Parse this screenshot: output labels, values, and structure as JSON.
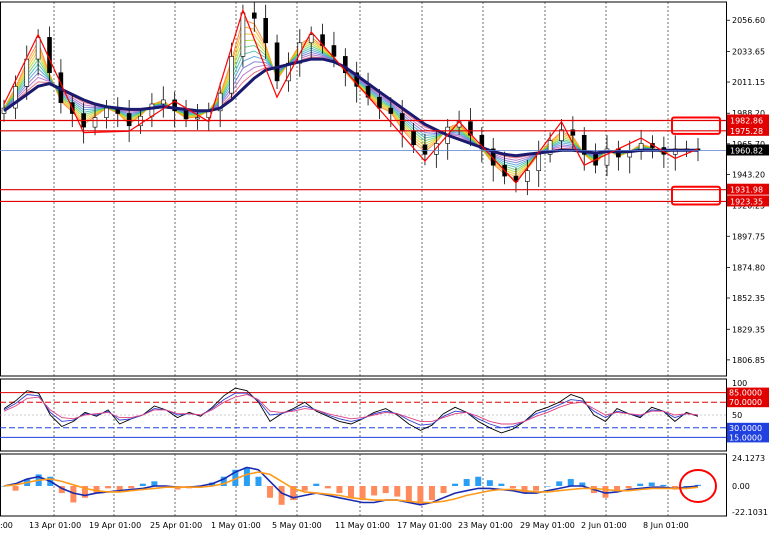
{
  "chart_data": [
    {
      "panel": "price",
      "type": "candlestick",
      "y_ticks": [
        "2056.60",
        "2033.65",
        "2011.15",
        "1988.20",
        "1965.70",
        "1943.20",
        "1920.25",
        "1897.75",
        "1874.80",
        "1852.35",
        "1829.35",
        "1806.85"
      ],
      "ylim": [
        1795,
        2070
      ],
      "x_ticks": [
        ":00",
        "13 Apr 01:00",
        "19 Apr 01:00",
        "25 Apr 01:00",
        "1 May 01:00",
        "5 May 01:00",
        "11 May 01:00",
        "17 May 01:00",
        "23 May 01:00",
        "29 May 01:00",
        "2 Jun 01:00",
        "8 Jun 01:00"
      ],
      "close_series": [
        1992,
        2008,
        2028,
        2044,
        2018,
        1996,
        1988,
        1978,
        1985,
        1992,
        1988,
        1979,
        1986,
        1995,
        1998,
        1990,
        1984,
        1985,
        1990,
        2003,
        2030,
        2062,
        2058,
        2040,
        2012,
        2025,
        2040,
        2046,
        2038,
        2030,
        2018,
        2008,
        2000,
        1992,
        1988,
        1975,
        1965,
        1958,
        1966,
        1978,
        1982,
        1972,
        1962,
        1950,
        1942,
        1938,
        1946,
        1958,
        1968,
        1976,
        1972,
        1958,
        1950,
        1962,
        1956,
        1960,
        1966,
        1963,
        1958,
        1962,
        1962,
        1961
      ],
      "trend_line": [
        1990,
        1996,
        2002,
        2008,
        2010,
        2006,
        2002,
        1998,
        1995,
        1993,
        1992,
        1991,
        1991,
        1992,
        1993,
        1992,
        1991,
        1990,
        1990,
        1992,
        1998,
        2006,
        2014,
        2020,
        2022,
        2024,
        2026,
        2028,
        2028,
        2026,
        2022,
        2016,
        2010,
        2004,
        1998,
        1992,
        1986,
        1980,
        1976,
        1972,
        1969,
        1966,
        1963,
        1960,
        1958,
        1957,
        1958,
        1959,
        1960,
        1961,
        1961,
        1960,
        1959,
        1960,
        1960,
        1960,
        1961,
        1961,
        1961,
        1961,
        1961,
        1961
      ],
      "zigzag": [
        [
          0,
          1995
        ],
        [
          3,
          2046
        ],
        [
          7,
          1974
        ],
        [
          11,
          1975
        ],
        [
          15,
          1997
        ],
        [
          18,
          1982
        ],
        [
          21,
          2064
        ],
        [
          24,
          2000
        ],
        [
          27,
          2048
        ],
        [
          37,
          1953
        ],
        [
          40,
          1982
        ],
        [
          45,
          1937
        ],
        [
          49,
          1982
        ],
        [
          51,
          1950
        ],
        [
          56,
          1970
        ],
        [
          59,
          1955
        ],
        [
          61,
          1962
        ]
      ],
      "levels": [
        {
          "value": 1982.86,
          "label": "1982.86",
          "color": "#e00000"
        },
        {
          "value": 1975.28,
          "label": "1975.28",
          "color": "#e00000"
        },
        {
          "value": 1931.98,
          "label": "1931.98",
          "color": "#e00000"
        },
        {
          "value": 1923.35,
          "label": "1923.35",
          "color": "#e00000"
        }
      ],
      "current_price": {
        "value": 1960.82,
        "label": "1960.82"
      },
      "highlight_boxes": [
        {
          "top": 1982.86,
          "bottom": 1975.28
        },
        {
          "top": 1931.98,
          "bottom": 1923.35
        }
      ]
    },
    {
      "panel": "oscillator",
      "type": "line",
      "y_ticks": [
        "100",
        "50"
      ],
      "ylim": [
        0,
        100
      ],
      "levels": [
        {
          "value": 85,
          "label": "85.0000",
          "color": "#e00000"
        },
        {
          "value": 70,
          "label": "70.0000",
          "color": "#e00000"
        },
        {
          "value": 30,
          "label": "30.0000",
          "color": "#2040e0"
        },
        {
          "value": 15,
          "label": "15.0000",
          "color": "#2040e0"
        }
      ],
      "series": [
        {
          "color": "#000000",
          "values": [
            60,
            72,
            88,
            84,
            50,
            32,
            40,
            54,
            48,
            58,
            36,
            44,
            50,
            64,
            58,
            46,
            54,
            48,
            62,
            80,
            92,
            88,
            70,
            40,
            52,
            60,
            70,
            56,
            48,
            40,
            36,
            44,
            54,
            60,
            50,
            36,
            26,
            34,
            52,
            62,
            54,
            40,
            30,
            22,
            28,
            40,
            56,
            62,
            70,
            82,
            76,
            50,
            40,
            60,
            52,
            46,
            62,
            56,
            40,
            54,
            48
          ]
        },
        {
          "color": "#3040d0",
          "values": [
            58,
            68,
            82,
            80,
            54,
            40,
            42,
            52,
            50,
            56,
            42,
            44,
            50,
            60,
            58,
            50,
            52,
            50,
            60,
            74,
            84,
            84,
            72,
            50,
            52,
            58,
            64,
            58,
            50,
            44,
            40,
            44,
            52,
            56,
            52,
            42,
            34,
            36,
            48,
            56,
            54,
            44,
            36,
            30,
            32,
            40,
            52,
            58,
            66,
            74,
            72,
            56,
            46,
            56,
            52,
            48,
            58,
            56,
            46,
            52,
            50
          ]
        },
        {
          "color": "#e04080",
          "values": [
            56,
            64,
            76,
            78,
            58,
            46,
            44,
            50,
            52,
            54,
            46,
            46,
            50,
            58,
            58,
            52,
            52,
            50,
            58,
            70,
            78,
            82,
            74,
            56,
            54,
            56,
            60,
            58,
            52,
            48,
            44,
            46,
            50,
            54,
            52,
            46,
            40,
            40,
            46,
            52,
            54,
            48,
            40,
            36,
            36,
            40,
            48,
            54,
            62,
            68,
            70,
            60,
            50,
            54,
            52,
            50,
            56,
            56,
            50,
            52,
            50
          ]
        }
      ]
    },
    {
      "panel": "macd",
      "type": "bar",
      "y_ticks": [
        "24.1273",
        "0.00",
        "-22.1031"
      ],
      "ylim": [
        -22.1031,
        24.1273
      ],
      "histogram": [
        0,
        -4,
        6,
        10,
        8,
        -6,
        -14,
        -10,
        -6,
        -2,
        -4,
        -2,
        2,
        4,
        0,
        -3,
        -2,
        -1,
        3,
        8,
        14,
        16,
        8,
        -10,
        -16,
        -12,
        -4,
        2,
        -2,
        -6,
        -10,
        -12,
        -8,
        -6,
        -9,
        -14,
        -16,
        -12,
        -6,
        2,
        6,
        8,
        5,
        2,
        -2,
        -6,
        -4,
        0,
        4,
        6,
        3,
        -6,
        -10,
        -4,
        -2,
        2,
        3,
        1,
        -3,
        0,
        1
      ],
      "macd_line": [
        0,
        2,
        6,
        8,
        4,
        -2,
        -6,
        -8,
        -6,
        -5,
        -4,
        -3,
        -2,
        0,
        0,
        -1,
        -1,
        0,
        2,
        6,
        12,
        16,
        14,
        4,
        -6,
        -10,
        -8,
        -6,
        -8,
        -10,
        -12,
        -14,
        -14,
        -12,
        -12,
        -14,
        -16,
        -14,
        -10,
        -6,
        -4,
        -2,
        -2,
        -3,
        -4,
        -6,
        -6,
        -4,
        -2,
        0,
        0,
        -3,
        -6,
        -5,
        -3,
        -2,
        -1,
        -1,
        -2,
        -1,
        0
      ],
      "signal_line": [
        0,
        1,
        3,
        5,
        6,
        4,
        1,
        -2,
        -4,
        -5,
        -5,
        -4,
        -3,
        -2,
        -1,
        -1,
        -1,
        -1,
        0,
        2,
        6,
        10,
        12,
        10,
        4,
        -2,
        -5,
        -6,
        -7,
        -8,
        -10,
        -11,
        -12,
        -12,
        -12,
        -13,
        -14,
        -14,
        -13,
        -11,
        -8,
        -6,
        -4,
        -3,
        -3,
        -4,
        -5,
        -5,
        -4,
        -3,
        -2,
        -2,
        -3,
        -4,
        -4,
        -3,
        -2,
        -2,
        -2,
        -2,
        -1
      ],
      "highlight_circle_at": "last"
    }
  ]
}
